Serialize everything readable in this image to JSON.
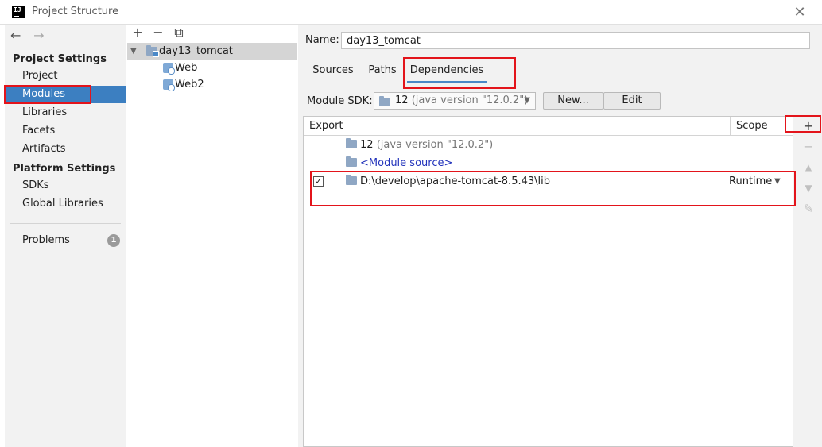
{
  "window": {
    "title": "Project Structure",
    "app_icon_text": "IJ",
    "close_glyph": "✕"
  },
  "nav": {
    "back_glyph": "←",
    "forward_glyph": "→",
    "project_settings_header": "Project Settings",
    "project_items": [
      "Project",
      "Modules",
      "Libraries",
      "Facets",
      "Artifacts"
    ],
    "platform_settings_header": "Platform Settings",
    "platform_items": [
      "SDKs",
      "Global Libraries"
    ],
    "problems_label": "Problems",
    "problems_count": "1",
    "selected": "Modules"
  },
  "tree": {
    "toolbar": {
      "add": "+",
      "remove": "−",
      "copy": "⧉"
    },
    "root": "day13_tomcat",
    "children": [
      "Web",
      "Web2"
    ]
  },
  "module": {
    "name_label": "Name:",
    "name_value": "day13_tomcat",
    "tabs": [
      "Sources",
      "Paths",
      "Dependencies"
    ],
    "active_tab": "Dependencies",
    "sdk_label": "Module SDK:",
    "sdk_value_main": "12",
    "sdk_value_detail": "(java version \"12.0.2\")",
    "new_button": "New...",
    "edit_button": "Edit"
  },
  "dependencies": {
    "columns": {
      "export": "Export",
      "scope": "Scope"
    },
    "rows": [
      {
        "main": "12",
        "detail": "(java version \"12.0.2\")",
        "checked": null,
        "scope": ""
      },
      {
        "main": "<Module source>",
        "detail": "",
        "checked": null,
        "scope": ""
      },
      {
        "main": "D:\\develop\\apache-tomcat-8.5.43\\lib",
        "detail": "",
        "checked": true,
        "scope": "Runtime"
      }
    ],
    "check_glyph": "✓",
    "side_tools": {
      "add": "+",
      "remove": "−",
      "up": "▲",
      "down": "▼",
      "edit": "✎"
    }
  },
  "colors": {
    "selection": "#3c7fc1",
    "highlight_box": "#e3141b",
    "module_source_link": "#2233bb"
  }
}
